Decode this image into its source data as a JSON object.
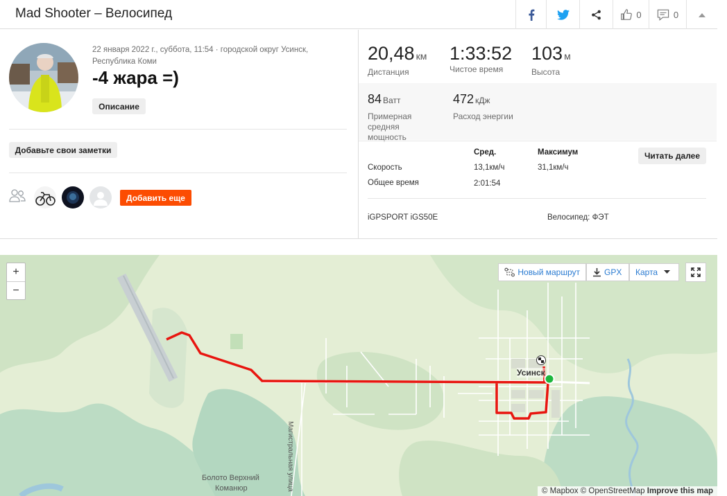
{
  "header": {
    "title": "Mad Shooter – Велосипед",
    "kudos_count": "0",
    "comments_count": "0"
  },
  "activity": {
    "meta": "22 января 2022 г., суббота, 11:54 · городской округ Усинск, Республика Коми",
    "name": "-4 жара =)",
    "description_button": "Описание",
    "notes_button": "Добавьте свои заметки",
    "add_more_button": "Добавить еще"
  },
  "stats": {
    "distance": {
      "value": "20,48",
      "unit": "км",
      "label": "Дистанция"
    },
    "moving_time": {
      "value": "1:33:52",
      "label": "Чистое время"
    },
    "elevation": {
      "value": "103",
      "unit": "м",
      "label": "Высота"
    },
    "power": {
      "value": "84",
      "unit": "Ватт",
      "label": "Примерная средняя мощность"
    },
    "energy": {
      "value": "472",
      "unit": "кДж",
      "label": "Расход энергии"
    }
  },
  "details": {
    "col_avg": "Сред.",
    "col_max": "Максимум",
    "read_more": "Читать далее",
    "rows": [
      {
        "label": "Скорость",
        "avg": "13,1км/ч",
        "max": "31,1км/ч"
      },
      {
        "label": "Общее время",
        "avg": "2:01:54",
        "max": ""
      }
    ],
    "device": "iGPSPORT iGS50E",
    "bike": "Велосипед: ФЭТ"
  },
  "map": {
    "zoom_in": "+",
    "zoom_out": "−",
    "new_route": "Новый маршрут",
    "gpx": "GPX",
    "map_type": "Карта",
    "town_label": "Усинск",
    "street_label": "Магистральная улица",
    "swamp_label_1": "Болото Верхний",
    "swamp_label_2": "Команюр",
    "attribution_mapbox": "© Mapbox",
    "attribution_osm": "© OpenStreetMap",
    "attribution_improve": "Improve this map",
    "route_color": "#e8150f"
  }
}
